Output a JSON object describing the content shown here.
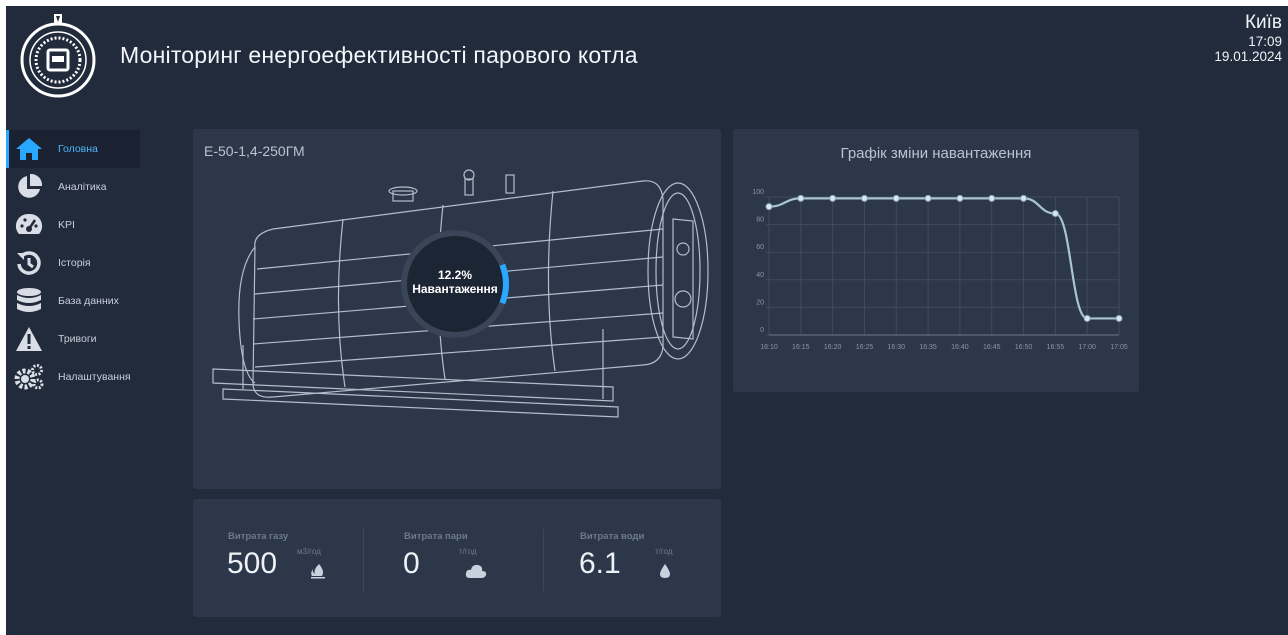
{
  "header": {
    "title": "Моніторинг енергоефективності парового котла",
    "city": "Київ",
    "time": "17:09",
    "date": "19.01.2024"
  },
  "sidebar": {
    "active": "Головна",
    "items": [
      {
        "label": "Головна",
        "icon": "home-icon"
      },
      {
        "label": "Аналітика",
        "icon": "pie-chart-icon"
      },
      {
        "label": "KPI",
        "icon": "gauge-icon"
      },
      {
        "label": "Історія",
        "icon": "history-icon"
      },
      {
        "label": "База данних",
        "icon": "database-icon"
      },
      {
        "label": "Тривоги",
        "icon": "warning-icon"
      },
      {
        "label": "Налаштування",
        "icon": "gears-icon"
      }
    ]
  },
  "boiler": {
    "model": "Е-50-1,4-250ГМ",
    "load_value": "12.2%",
    "load_label": "Навантаження",
    "load_fraction": 0.122
  },
  "metrics": [
    {
      "label": "Витрата газу",
      "value": "500",
      "unit": "м3/год",
      "icon": "flame-icon"
    },
    {
      "label": "Витрата пари",
      "value": "0",
      "unit": "т/год",
      "icon": "cloud-icon"
    },
    {
      "label": "Витрата води",
      "value": "6.1",
      "unit": "т/год",
      "icon": "water-drop-icon"
    }
  ],
  "colors": {
    "accent": "#2aa8ff",
    "background": "#222b3b",
    "panel": "#2c3749",
    "line": "#a9c4d8"
  },
  "chart_data": {
    "type": "line",
    "title": "Графік зміни навантаження",
    "categories": [
      "16:10",
      "16:15",
      "16:20",
      "16:25",
      "16:30",
      "16:35",
      "16:40",
      "16:45",
      "16:50",
      "16:55",
      "17:00",
      "17:05"
    ],
    "values": [
      93,
      99,
      99,
      99,
      99,
      99,
      99,
      99,
      99,
      88,
      12,
      12
    ],
    "yticks": [
      0,
      20,
      40,
      60,
      80,
      100
    ],
    "ylim": [
      0,
      100
    ],
    "grid": true,
    "xlabel": "",
    "ylabel": ""
  }
}
